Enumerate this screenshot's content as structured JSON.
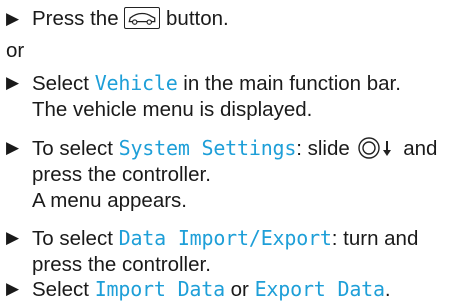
{
  "step1": {
    "bullet": "▶",
    "before": "Press the",
    "icon": "car-button-icon",
    "after": "button."
  },
  "or_text": "or",
  "step2": {
    "bullet": "▶",
    "pre": "Select",
    "highlight": "Vehicle",
    "post": "in the main function bar.",
    "line2": "The vehicle menu is displayed."
  },
  "step3": {
    "bullet": "▶",
    "pre": "To select",
    "highlight": "System Settings",
    "mid": ": slide",
    "icon": "controller-slide-down-icon",
    "post": "and",
    "line2": "press the controller.",
    "line3": "A menu appears."
  },
  "step4": {
    "bullet": "▶",
    "pre": "To select",
    "highlight": "Data Import/Export",
    "post": ": turn and",
    "line2": "press the controller."
  },
  "step5": {
    "bullet": "▶",
    "pre": "Select",
    "highlight1": "Import Data",
    "mid": "or",
    "highlight2": "Export Data",
    "post": "."
  },
  "colors": {
    "highlight": "#1e9fd8",
    "text": "#1a1a1a"
  }
}
